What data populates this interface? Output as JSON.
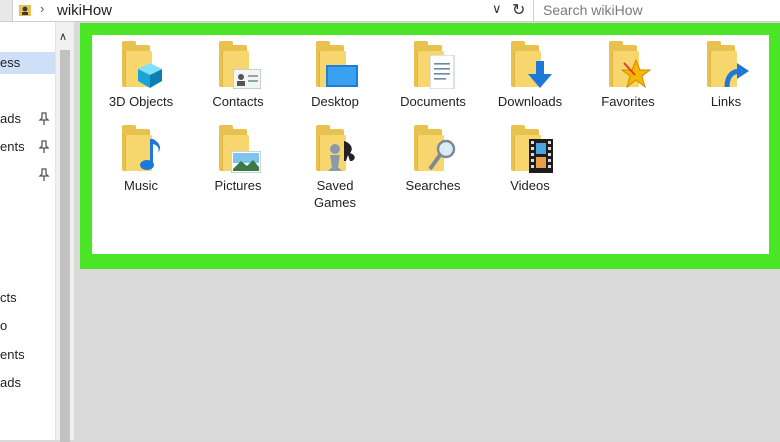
{
  "address_bar": {
    "path": "wikiHow",
    "search_placeholder": "Search wikiHow"
  },
  "sidebar": {
    "items": [
      {
        "label": "ess",
        "selected": true,
        "pinned": false
      },
      {
        "label": "ads",
        "pinned": true
      },
      {
        "label": "ents",
        "pinned": true
      },
      {
        "label": "",
        "pinned": true
      },
      {
        "label": "cts",
        "pinned": false
      },
      {
        "label": "",
        "pinned": false
      },
      {
        "label": "ents",
        "pinned": false
      },
      {
        "label": "ads",
        "pinned": false
      }
    ]
  },
  "folders": [
    {
      "label": "3D Objects",
      "icon": "3d-objects-icon"
    },
    {
      "label": "Contacts",
      "icon": "contact-card-icon"
    },
    {
      "label": "Desktop",
      "icon": "desktop-icon"
    },
    {
      "label": "Documents",
      "icon": "document-icon"
    },
    {
      "label": "Downloads",
      "icon": "download-arrow-icon"
    },
    {
      "label": "Favorites",
      "icon": "star-icon"
    },
    {
      "label": "Links",
      "icon": "link-arrow-icon"
    },
    {
      "label": "Music",
      "icon": "music-note-icon"
    },
    {
      "label": "Pictures",
      "icon": "picture-icon"
    },
    {
      "label": "Saved Games",
      "icon": "chess-piece-icon"
    },
    {
      "label": "Searches",
      "icon": "magnifier-icon"
    },
    {
      "label": "Videos",
      "icon": "film-strip-icon"
    }
  ],
  "colors": {
    "highlight": "#4ae626",
    "folder": "#f7d66e",
    "selection": "#cde0f7"
  }
}
